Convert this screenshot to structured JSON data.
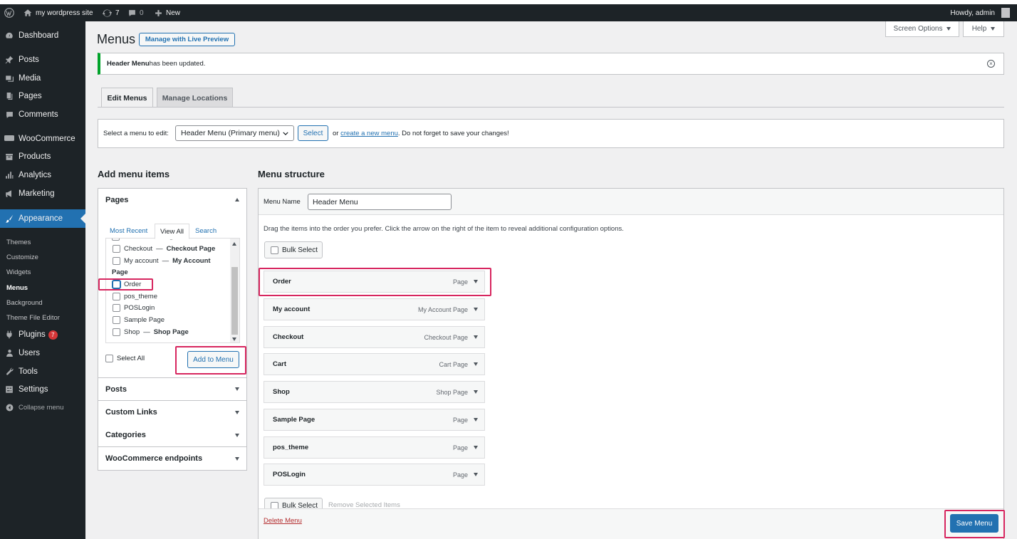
{
  "admin_bar": {
    "site_name": "my wordpress site",
    "updates_count": "7",
    "comments_count": "0",
    "new_label": "New",
    "greeting": "Howdy, admin"
  },
  "sidebar": {
    "items": [
      {
        "label": "Dashboard"
      },
      {
        "label": "Posts"
      },
      {
        "label": "Media"
      },
      {
        "label": "Pages"
      },
      {
        "label": "Comments"
      },
      {
        "label": "WooCommerce"
      },
      {
        "label": "Products"
      },
      {
        "label": "Analytics"
      },
      {
        "label": "Marketing"
      },
      {
        "label": "Appearance"
      },
      {
        "label": "Plugins",
        "badge": "7"
      },
      {
        "label": "Users"
      },
      {
        "label": "Tools"
      },
      {
        "label": "Settings"
      },
      {
        "label": "Collapse menu"
      }
    ],
    "submenu": [
      "Themes",
      "Customize",
      "Widgets",
      "Menus",
      "Background",
      "Theme File Editor"
    ]
  },
  "header": {
    "title": "Menus",
    "live_preview": "Manage with Live Preview",
    "screen_options": "Screen Options",
    "help": "Help"
  },
  "notice": {
    "bold": "Header Menu",
    "text": " has been updated."
  },
  "tabs": [
    "Edit Menus",
    "Manage Locations"
  ],
  "select_bar": {
    "label": "Select a menu to edit:",
    "selected": "Header Menu (Primary menu)",
    "select_button": "Select",
    "or": "or",
    "create_link": "create a new menu",
    "after": ". Do not forget to save your changes!"
  },
  "add_items": {
    "heading": "Add menu items",
    "pages_title": "Pages",
    "subtabs": [
      "Most Recent",
      "View All",
      "Search"
    ],
    "pages": [
      {
        "name": "Checkout",
        "suffix": "Checkout Page"
      },
      {
        "name": "My account",
        "suffix": "My Account",
        "suffix2": "Page"
      },
      {
        "name": "Order"
      },
      {
        "name": "pos_theme"
      },
      {
        "name": "POSLogin"
      },
      {
        "name": "Sample Page"
      },
      {
        "name": "Shop",
        "suffix": "Shop Page"
      }
    ],
    "dash": " — ",
    "select_all": "Select All",
    "add_button": "Add to Menu",
    "sections": [
      "Posts",
      "Custom Links",
      "Categories",
      "WooCommerce endpoints"
    ]
  },
  "structure": {
    "heading": "Menu structure",
    "name_label": "Menu Name",
    "name_value": "Header Menu",
    "instructions": "Drag the items into the order you prefer. Click the arrow on the right of the item to reveal additional configuration options.",
    "bulk_select": "Bulk Select",
    "items": [
      {
        "title": "Order",
        "type": "Page"
      },
      {
        "title": "My account",
        "type": "My Account Page"
      },
      {
        "title": "Checkout",
        "type": "Checkout Page"
      },
      {
        "title": "Cart",
        "type": "Cart Page"
      },
      {
        "title": "Shop",
        "type": "Shop Page"
      },
      {
        "title": "Sample Page",
        "type": "Page"
      },
      {
        "title": "pos_theme",
        "type": "Page"
      },
      {
        "title": "POSLogin",
        "type": "Page"
      }
    ],
    "remove_selected": "Remove Selected Items",
    "delete_menu": "Delete Menu",
    "save_button": "Save Menu"
  },
  "colors": {
    "accent": "#2271b1",
    "admin_dark": "#1d2327",
    "highlight": "#d7265f",
    "success": "#00a32a"
  }
}
